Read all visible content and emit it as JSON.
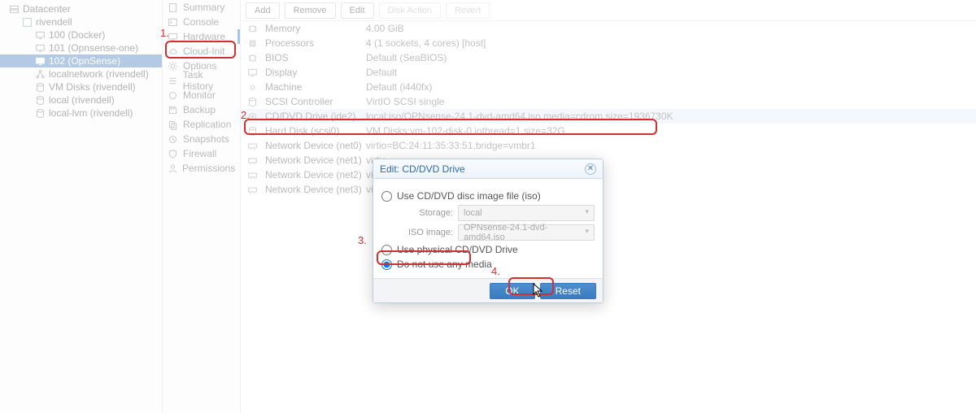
{
  "tree": {
    "root": "Datacenter",
    "node": "rivendell",
    "children": [
      {
        "label": "100 (Docker)",
        "icon": "monitor"
      },
      {
        "label": "101 (Opnsense-one)",
        "icon": "monitor"
      },
      {
        "label": "102 (OpnSense)",
        "icon": "monitor",
        "selected": true
      },
      {
        "label": "localnetwork (rivendell)",
        "icon": "network"
      },
      {
        "label": "VM Disks (rivendell)",
        "icon": "disk"
      },
      {
        "label": "local (rivendell)",
        "icon": "disk"
      },
      {
        "label": "local-lvm (rivendell)",
        "icon": "disk"
      }
    ]
  },
  "nav": [
    {
      "label": "Summary",
      "icon": "file"
    },
    {
      "label": "Console",
      "icon": "terminal"
    },
    {
      "label": "Hardware",
      "icon": "monitor",
      "active": true
    },
    {
      "label": "Cloud-Init",
      "icon": "cloud"
    },
    {
      "label": "Options",
      "icon": "gear"
    },
    {
      "label": "Task History",
      "icon": "list"
    },
    {
      "label": "Monitor",
      "icon": "circle"
    },
    {
      "label": "Backup",
      "icon": "save"
    },
    {
      "label": "Replication",
      "icon": "copy"
    },
    {
      "label": "Snapshots",
      "icon": "history"
    },
    {
      "label": "Firewall",
      "icon": "shield"
    },
    {
      "label": "Permissions",
      "icon": "user"
    }
  ],
  "toolbar": {
    "add": "Add",
    "remove": "Remove",
    "edit": "Edit",
    "disk_action": "Disk Action",
    "revert": "Revert"
  },
  "hw": [
    {
      "name": "Memory",
      "val": "4.00 GiB",
      "icon": "chip"
    },
    {
      "name": "Processors",
      "val": "4 (1 sockets, 4 cores) [host]",
      "icon": "cpu"
    },
    {
      "name": "BIOS",
      "val": "Default (SeaBIOS)",
      "icon": "chip"
    },
    {
      "name": "Display",
      "val": "Default",
      "icon": "monitor"
    },
    {
      "name": "Machine",
      "val": "Default (i440fx)",
      "icon": "gear"
    },
    {
      "name": "SCSI Controller",
      "val": "VirtIO SCSI single",
      "icon": "disk"
    },
    {
      "name": "CD/DVD Drive (ide2)",
      "val": "local:iso/OPNsense-24.1-dvd-amd64.iso,media=cdrom,size=1936730K",
      "icon": "disc",
      "highlight": true
    },
    {
      "name": "Hard Disk (scsi0)",
      "val": "VM Disks:vm-102-disk-0,iothread=1,size=32G",
      "icon": "disk"
    },
    {
      "name": "Network Device (net0)",
      "val": "virtio=BC:24:11:35:33:51,bridge=vmbr1",
      "icon": "net"
    },
    {
      "name": "Network Device (net1)",
      "val": "virtio",
      "icon": "net"
    },
    {
      "name": "Network Device (net2)",
      "val": "virtio",
      "icon": "net"
    },
    {
      "name": "Network Device (net3)",
      "val": "virtio",
      "icon": "net"
    }
  ],
  "dialog": {
    "title": "Edit: CD/DVD Drive",
    "opt_iso": "Use CD/DVD disc image file (iso)",
    "storage_lbl": "Storage:",
    "storage_val": "local",
    "iso_lbl": "ISO image:",
    "iso_val": "OPNsense-24.1-dvd-amd64.iso",
    "opt_physical": "Use physical CD/DVD Drive",
    "opt_nomedia": "Do not use any media",
    "ok": "OK",
    "reset": "Reset"
  },
  "annotations": {
    "n1": "1.",
    "n2": "2.",
    "n3": "3.",
    "n4": "4."
  }
}
